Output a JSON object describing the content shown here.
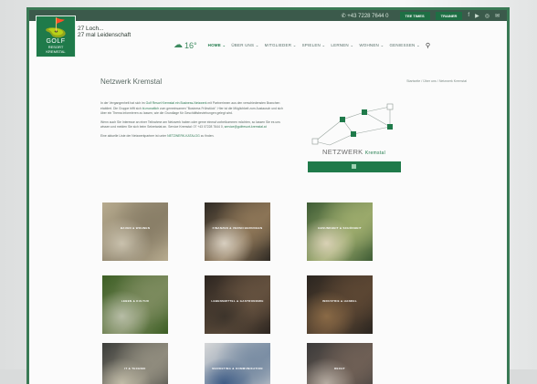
{
  "topbar": {
    "phone": "+43 7228 7644 0",
    "btn1": "TEE TIMES",
    "btn2": "TRAINER",
    "social": [
      "f",
      "▶",
      "◎",
      "✉"
    ]
  },
  "logo": {
    "line1": "GOLF",
    "line2": "RESORT",
    "line3": "KREMSTAL"
  },
  "tagline": {
    "line1": "27 Loch...",
    "line2": "27 mal Leidenschaft"
  },
  "weather": {
    "temp": "16°"
  },
  "nav": [
    "HOME ⌄",
    "ÜBER UNS ⌄",
    "MITGLIEDER ⌄",
    "SPIELEN ⌄",
    "LERNEN ⌄",
    "WOHNEN ⌄",
    "GENIESSEN ⌄"
  ],
  "page": {
    "title": "Netzwerk Kremstal",
    "breadcrumb": "Startseite  /  Über uns  /  Netzwerk Kremstal"
  },
  "paragraphs": [
    {
      "pre": "In der Vergangenheit hat sich im ",
      "hl": "Golf Resort Kremstal ein Business-Netzwerk",
      "post": " mit Partnerinnen aus den verschiedensten Branchen etabliert. Die Gruppe trifft sich ",
      "hl2": "bi-monatlich",
      "post2": " zum gemeinsamen \"Business Frühstück\". Hier ist die Möglichkeit zum Austausch und sich über ein Thema informieren zu lassen, wie die Grundlage für Geschäftsbeziehungen gelegt wird."
    },
    {
      "pre": "Wenn auch Sie Interesse an einer Teilnahme am Netzwerk haben oder gerne einmal vorbeikommen möchten, so lassen Sie es uns wissen und melden Sie sich beim Sekretariat an. Service Kremstal: 07 +43 07228 7644 0, ",
      "hl": "service@golfresort-kremstal.at",
      "post": "",
      "hl2": "",
      "post2": ""
    },
    {
      "pre": "Eine aktuelle Liste der Netzwerkpartner ist unter ",
      "hl": "NETZWERK-KATALOG",
      "post": " zu finden.",
      "hl2": "",
      "post2": ""
    }
  ],
  "network": {
    "label": "NETZWERK",
    "label_small": "Kremstal"
  },
  "tiles": [
    {
      "caption": "BAUEN & WOHNEN",
      "colors": [
        "#b7ab8f",
        "#8a7f68",
        "#c9c1ad"
      ]
    },
    {
      "caption": "FINANZEN & VERSICHERUNGEN",
      "colors": [
        "#2f2a24",
        "#8b7456",
        "#d8cfc0"
      ]
    },
    {
      "caption": "GESUNDHEIT & SCHÖNHEIT",
      "colors": [
        "#3e5c35",
        "#9aa96b",
        "#d9d1b5"
      ]
    },
    {
      "caption": "LEBEN & KULTUR",
      "colors": [
        "#3c5e24",
        "#7b8a5d",
        "#b7bda6"
      ]
    },
    {
      "caption": "LEBENSMITTEL & GASTRONOMIE",
      "colors": [
        "#2c2520",
        "#63503e",
        "#3d342b"
      ]
    },
    {
      "caption": "INDUSTRIE & HANDEL",
      "colors": [
        "#2a2520",
        "#5b4633",
        "#8a6a46"
      ]
    },
    {
      "caption": "IT & TECHNIK",
      "colors": [
        "#3c3d3a",
        "#8f8b7d",
        "#c2bca8"
      ]
    },
    {
      "caption": "MARKETING & KOMMUNIKATION",
      "colors": [
        "#d6d7d8",
        "#7b8ea4",
        "#3e5c86"
      ]
    },
    {
      "caption": "RECHT",
      "colors": [
        "#3b3a3a",
        "#6e5f55",
        "#b6aca2"
      ]
    }
  ]
}
